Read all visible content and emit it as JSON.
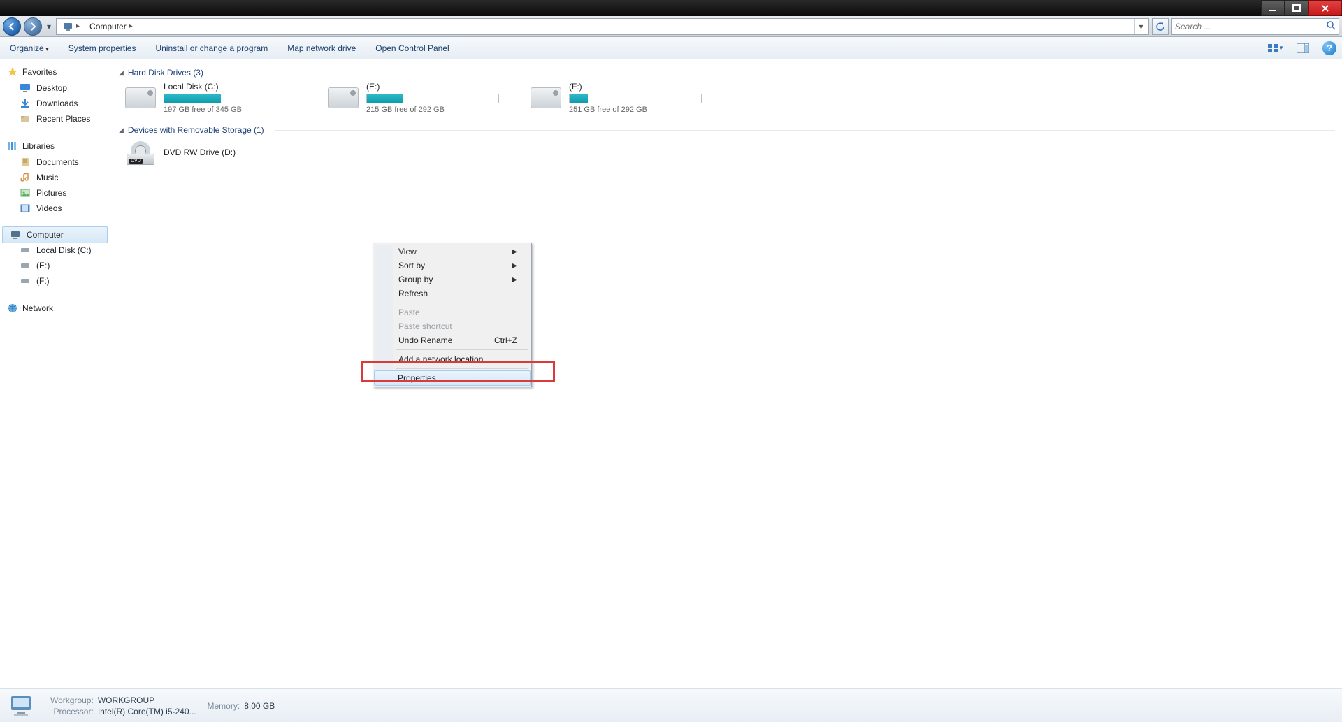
{
  "breadcrumb": {
    "root_chevron": "▸",
    "location": "Computer",
    "trail_chevron": "▸"
  },
  "search": {
    "placeholder": "Search ..."
  },
  "toolbar": {
    "organize": "Organize",
    "system_properties": "System properties",
    "uninstall": "Uninstall or change a program",
    "map_drive": "Map network drive",
    "control_panel": "Open Control Panel"
  },
  "sidebar": {
    "favorites": {
      "label": "Favorites",
      "items": [
        {
          "label": "Desktop"
        },
        {
          "label": "Downloads"
        },
        {
          "label": "Recent Places"
        }
      ]
    },
    "libraries": {
      "label": "Libraries",
      "items": [
        {
          "label": "Documents"
        },
        {
          "label": "Music"
        },
        {
          "label": "Pictures"
        },
        {
          "label": "Videos"
        }
      ]
    },
    "computer": {
      "label": "Computer",
      "items": [
        {
          "label": "Local Disk (C:)"
        },
        {
          "label": "(E:)"
        },
        {
          "label": "(F:)"
        }
      ]
    },
    "network": {
      "label": "Network"
    }
  },
  "sections": {
    "hdd": {
      "title": "Hard Disk Drives (3)",
      "drives": [
        {
          "name": "Local Disk (C:)",
          "free": "197 GB free of 345 GB",
          "fill_pct": 43
        },
        {
          "name": "(E:)",
          "free": "215 GB free of 292 GB",
          "fill_pct": 27
        },
        {
          "name": "(F:)",
          "free": "251 GB free of 292 GB",
          "fill_pct": 14
        }
      ]
    },
    "removable": {
      "title": "Devices with Removable Storage (1)",
      "items": [
        {
          "name": "DVD RW Drive (D:)"
        }
      ]
    }
  },
  "context_menu": {
    "view": "View",
    "sort_by": "Sort by",
    "group_by": "Group by",
    "refresh": "Refresh",
    "paste": "Paste",
    "paste_shortcut": "Paste shortcut",
    "undo_rename": "Undo Rename",
    "undo_rename_key": "Ctrl+Z",
    "add_net_loc": "Add a network location",
    "properties": "Properties"
  },
  "status": {
    "workgroup_k": "Workgroup:",
    "workgroup_v": "WORKGROUP",
    "processor_k": "Processor:",
    "processor_v": "Intel(R) Core(TM) i5-240...",
    "memory_k": "Memory:",
    "memory_v": "8.00 GB"
  }
}
